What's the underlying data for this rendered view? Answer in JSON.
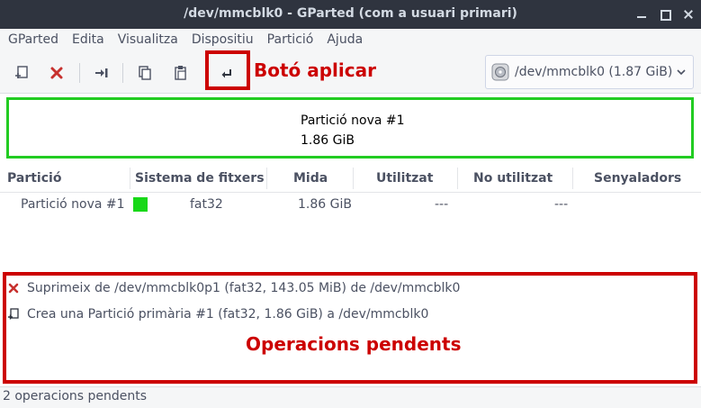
{
  "window": {
    "title": "/dev/mmcblk0 - GParted (com a usuari primari)"
  },
  "menubar": {
    "items": [
      "GParted",
      "Edita",
      "Visualitza",
      "Dispositiu",
      "Partició",
      "Ajuda"
    ]
  },
  "toolbar": {
    "icons": [
      "new-partition-icon",
      "delete-icon",
      "resize-move-icon",
      "copy-icon",
      "paste-icon",
      "apply-icon"
    ],
    "device": {
      "label": "/dev/mmcblk0  (1.87 GiB)",
      "icon": "drive-icon"
    }
  },
  "annotations": {
    "apply_label": "Botó aplicar",
    "pending_label": "Operacions pendents"
  },
  "graph": {
    "name": "Partició nova #1",
    "size": "1.86 GiB",
    "color": "#22cc22"
  },
  "table": {
    "headers": [
      "Partició",
      "Sistema de fitxers",
      "Mida",
      "Utilitzat",
      "No utilitzat",
      "Senyaladors"
    ],
    "rows": [
      {
        "partition": "Partició nova #1",
        "fs_color": "#18d818",
        "filesystem": "fat32",
        "size": "1.86 GiB",
        "used": "---",
        "unused": "---",
        "flags": ""
      }
    ]
  },
  "pending_operations": [
    {
      "icon": "delete-icon",
      "text": "Suprimeix de /dev/mmcblk0p1 (fat32, 143.05 MiB) de /dev/mmcblk0"
    },
    {
      "icon": "new-partition-icon",
      "text": "Crea una Partició primària #1 (fat32, 1.86 GiB) a /dev/mmcblk0"
    }
  ],
  "status": {
    "text": "2 operacions pendents"
  },
  "colors": {
    "titlebar": "#2f343f",
    "highlight": "#cc0000",
    "fat32": "#18d818"
  }
}
